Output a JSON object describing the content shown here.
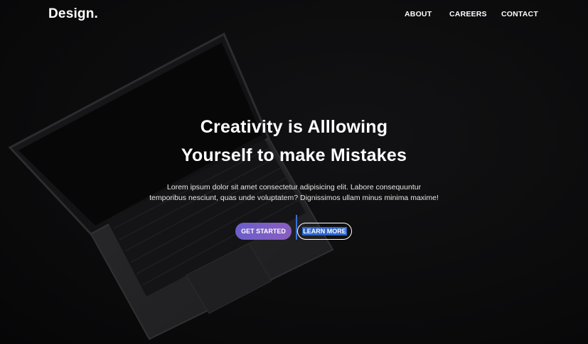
{
  "header": {
    "logo": "Design.",
    "nav": [
      {
        "label": "ABOUT"
      },
      {
        "label": "CAREERS"
      },
      {
        "label": "CONTACT"
      }
    ]
  },
  "hero": {
    "title_line1": "Creativity is Alllowing",
    "title_line2": "Yourself to make Mistakes",
    "text_line1": "Lorem ipsum dolor sit amet consectetur adipisicing elit. Labore consequuntur",
    "text_line2": "temporibus nesciunt, quas unde voluptatem? Dignissimos ullam minus minima maxime!",
    "primary_button": "GET STARTED",
    "secondary_button": "LEARN MORE"
  },
  "colors": {
    "background": "#0b0b0c",
    "primary_gradient_start": "#6b5fc9",
    "primary_gradient_end": "#8a5dc0",
    "selection_highlight": "#2f64c9"
  },
  "background_image": "laptop-photo"
}
